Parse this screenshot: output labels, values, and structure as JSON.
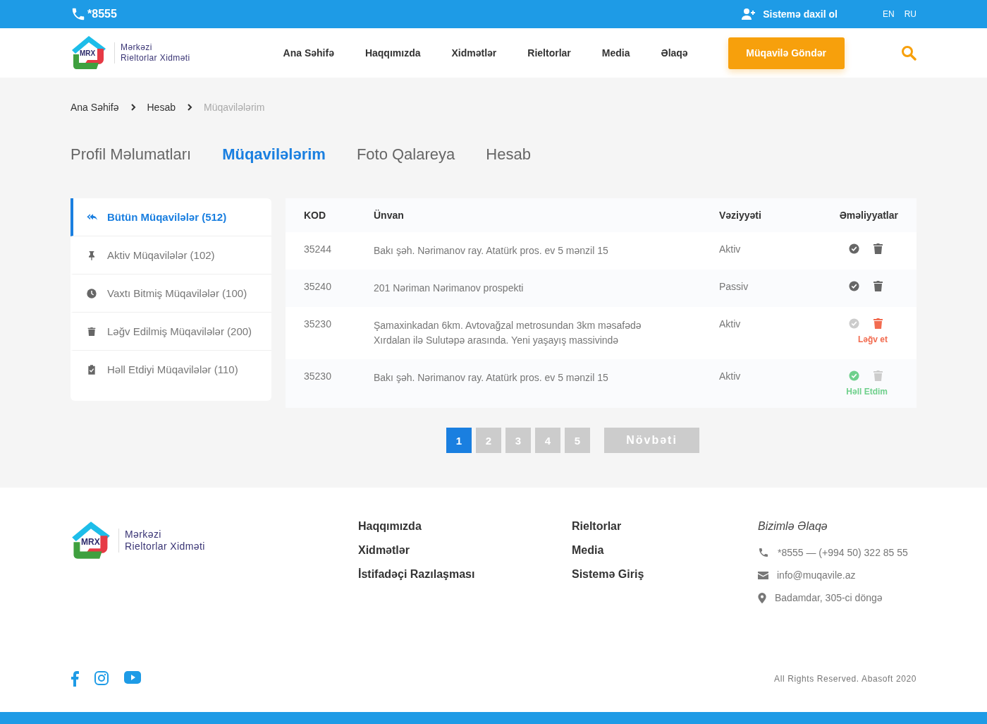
{
  "top_bar": {
    "phone": "*8555",
    "login": "Sistemə daxil ol",
    "languages": [
      "EN",
      "RU"
    ]
  },
  "header": {
    "logo": {
      "mark": "MRX",
      "line1": "Mərkəzi",
      "line2": "Rieltorlar Xidməti"
    },
    "nav": [
      "Ana Səhifə",
      "Haqqımızda",
      "Xidmətlər",
      "Rieltorlar",
      "Media",
      "Əlaqə"
    ],
    "cta": "Müqavilə Göndər"
  },
  "breadcrumbs": [
    "Ana Səhifə",
    "Hesab",
    "Müqavilələrim"
  ],
  "tabs": [
    {
      "label": "Profil Məlumatları",
      "selected": false
    },
    {
      "label": "Müqavilələrim",
      "selected": true
    },
    {
      "label": "Foto Qalareya",
      "selected": false
    },
    {
      "label": "Hesab",
      "selected": false
    }
  ],
  "sidebar": {
    "items": [
      {
        "kind": "reply",
        "label": "Bütün Müqavilələr (512)",
        "selected": true
      },
      {
        "kind": "pin",
        "label": "Aktiv Müqavilələr (102)",
        "selected": false
      },
      {
        "kind": "clock",
        "label": "Vaxtı Bitmiş Müqavilələr (100)",
        "selected": false
      },
      {
        "kind": "trash",
        "label": "Ləğv Edilmiş Müqavilələr (200)",
        "selected": false
      },
      {
        "kind": "clipboard",
        "label": "Həll Etdiyi Müqavilələr (110)",
        "selected": false
      }
    ]
  },
  "table": {
    "columns": [
      "KOD",
      "Ünvan",
      "Vəziyyəti",
      "Əməliyyatlar"
    ],
    "rows": [
      {
        "code": "35244",
        "address": [
          "Bakı şəh. Nərimanov ray. Atatürk pros. ev 5 mənzil 15"
        ],
        "status": "Aktiv",
        "kind": "default"
      },
      {
        "code": "35240",
        "address": [
          "201 Nəriman Nərimanov prospekti"
        ],
        "status": "Passiv",
        "kind": "default"
      },
      {
        "code": "35230",
        "address": [
          "Şamaxinkadan 6km. Avtovağzal metrosundan 3km məsafədə",
          "Xırdalan ilə Sulutəpə arasında. Yeni yaşayış massivində"
        ],
        "status": "Aktiv",
        "kind": "cancel",
        "action_label": "Ləğv et"
      },
      {
        "code": "35230",
        "address": [
          "Bakı şəh. Nərimanov ray. Atatürk pros. ev 5 mənzil 15"
        ],
        "status": "Aktiv",
        "kind": "resolved",
        "action_label": "Həll Etdim"
      }
    ]
  },
  "pagination": {
    "pages": [
      {
        "label": "1",
        "selected": true
      },
      {
        "label": "2",
        "selected": false
      },
      {
        "label": "3",
        "selected": false
      },
      {
        "label": "4",
        "selected": false
      },
      {
        "label": "5",
        "selected": false
      }
    ],
    "next": "Növbəti"
  },
  "footer": {
    "logo": {
      "mark": "MRX",
      "line1": "Mərkəzi",
      "line2": "Rieltorlar Xidməti"
    },
    "links_1": [
      "Haqqımızda",
      "Xidmətlər",
      "İstifadəçi Razılaşması"
    ],
    "links_2": [
      "Rieltorlar",
      "Media",
      "Sistemə Giriş"
    ],
    "contact": {
      "title": "Bizimlə Əlaqə",
      "items": [
        {
          "kind": "phone",
          "text": "*8555 —  (+994 50) 322 85 55"
        },
        {
          "kind": "mail",
          "text": "info@muqavile.az"
        },
        {
          "kind": "pin",
          "text": "Badamdar, 305-ci döngə"
        }
      ]
    },
    "social": [
      {
        "kind": "facebook"
      },
      {
        "kind": "instagram"
      },
      {
        "kind": "youtube"
      }
    ],
    "copyright": "All Rights Reserved. Abasoft 2020"
  }
}
